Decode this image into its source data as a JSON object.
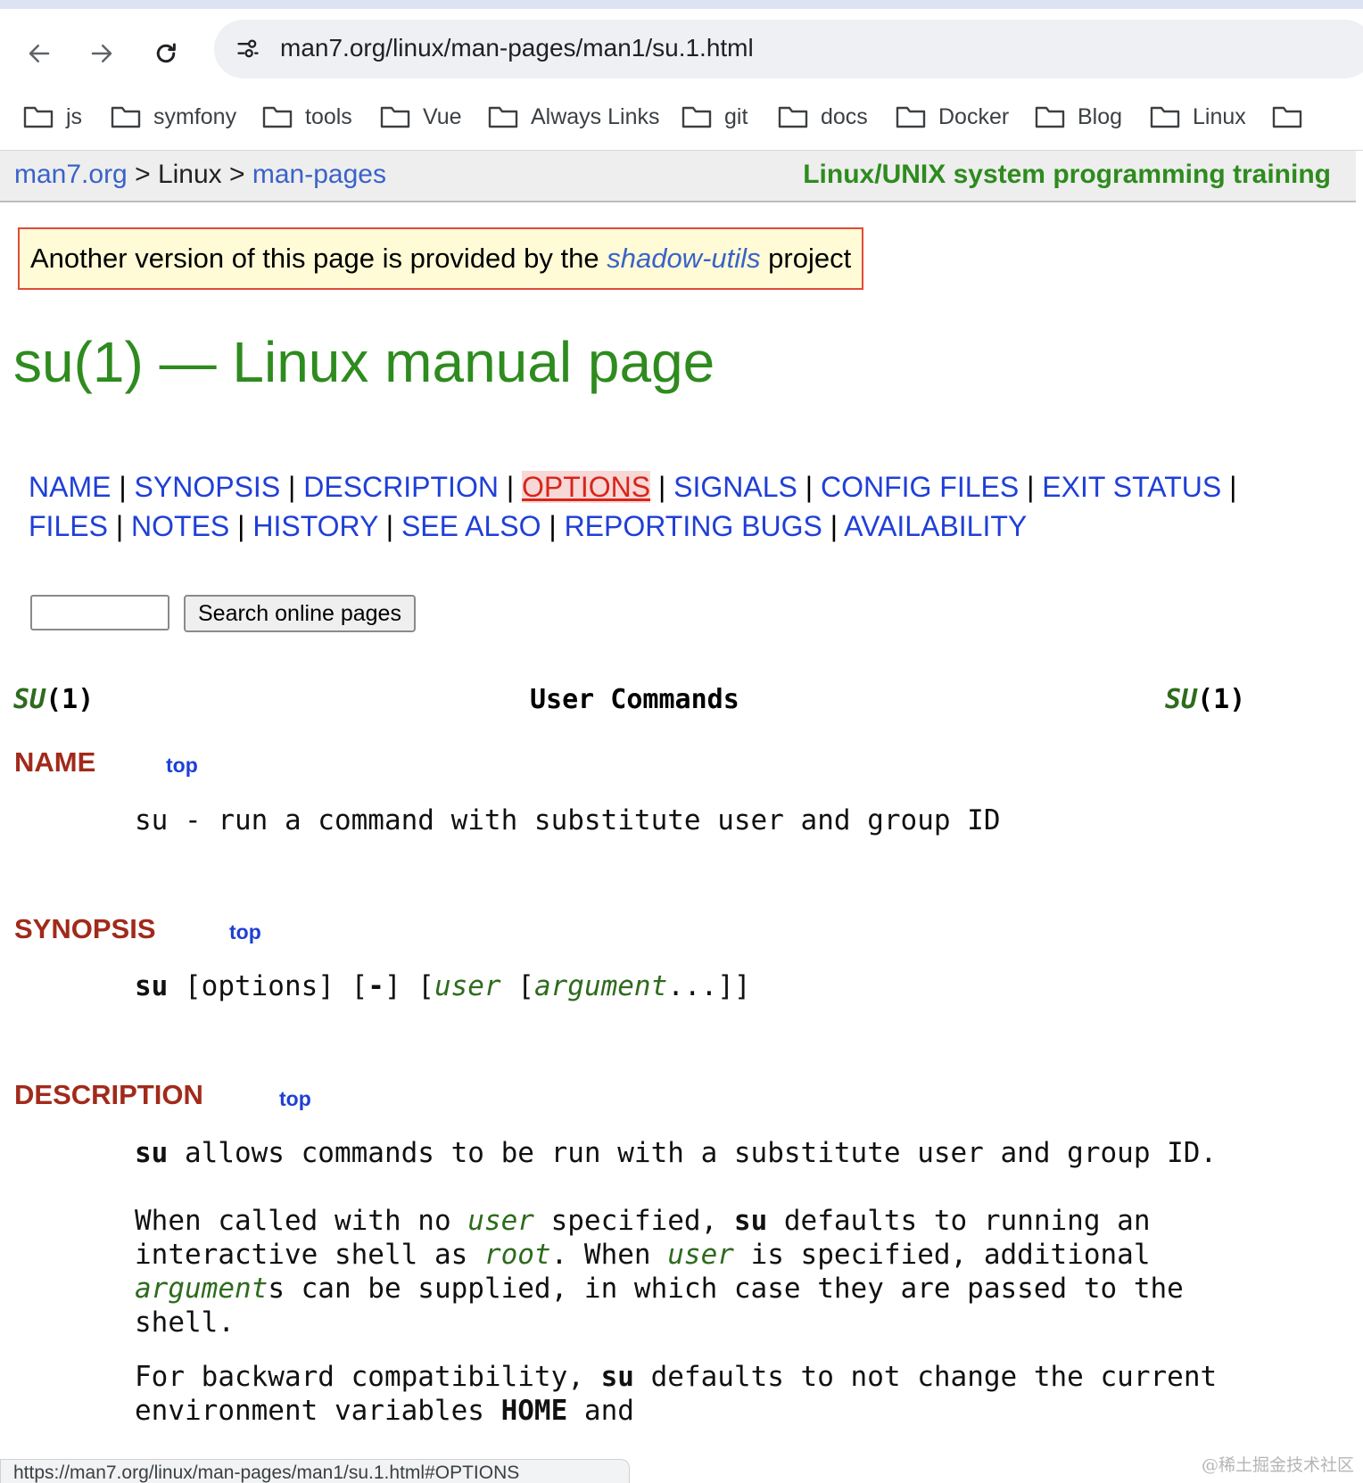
{
  "browser": {
    "url": "man7.org/linux/man-pages/man1/su.1.html",
    "bookmarks": [
      "js",
      "symfony",
      "tools",
      "Vue",
      "Always Links",
      "git",
      "docs",
      "Docker",
      "Blog",
      "Linux"
    ],
    "status_url": "https://man7.org/linux/man-pages/man1/su.1.html#OPTIONS"
  },
  "breadcrumb": {
    "home": "man7.org",
    "sep1": " > ",
    "section": "Linux",
    "sep2": " > ",
    "current": "man-pages",
    "training": "Linux/UNIX system programming training"
  },
  "notice": {
    "prefix": "Another version of this page is provided by the ",
    "link": "shadow-utils",
    "suffix": " project"
  },
  "title": "su(1) — Linux manual page",
  "toc": [
    "NAME",
    "SYNOPSIS",
    "DESCRIPTION",
    "OPTIONS",
    "SIGNALS",
    "CONFIG FILES",
    "EXIT STATUS",
    "FILES",
    "NOTES",
    "HISTORY",
    "SEE ALSO",
    "REPORTING BUGS",
    "AVAILABILITY"
  ],
  "toc_active": "OPTIONS",
  "search": {
    "value": "",
    "button": "Search online pages"
  },
  "man_header": {
    "left_name": "SU",
    "left_sec": "(1)",
    "center": "User Commands",
    "right_name": "SU",
    "right_sec": "(1)"
  },
  "top_label": "top",
  "sections": {
    "name": {
      "heading": "NAME",
      "text": "su - run a command with substitute user and group ID"
    },
    "synopsis": {
      "heading": "SYNOPSIS",
      "cmd": "su",
      "p1": " [options] [",
      "dash": "-",
      "p2": "] [",
      "user": "user",
      "p3": " [",
      "argument": "argument",
      "p4": "...]]"
    },
    "description": {
      "heading": "DESCRIPTION",
      "para1_cmd": "su",
      "para1": " allows commands to be run with a substitute user and group ID.",
      "para2": {
        "a": "When called with no ",
        "user": "user",
        "b": " specified, ",
        "su": "su",
        "c": " defaults to running an",
        "d": "interactive shell as ",
        "root": "root",
        "e": ". When ",
        "user2": "user",
        "f": " is specified, additional",
        "argument": "argument",
        "g": "s can be supplied, in which case they are passed to the",
        "h": "shell."
      },
      "para3": {
        "a": "For backward compatibility, ",
        "su": "su",
        "b": " defaults to not change the current",
        "c": "environment variables ",
        "home": "HOME",
        "d": " and"
      }
    }
  },
  "watermark": "@稀土掘金技术社区"
}
